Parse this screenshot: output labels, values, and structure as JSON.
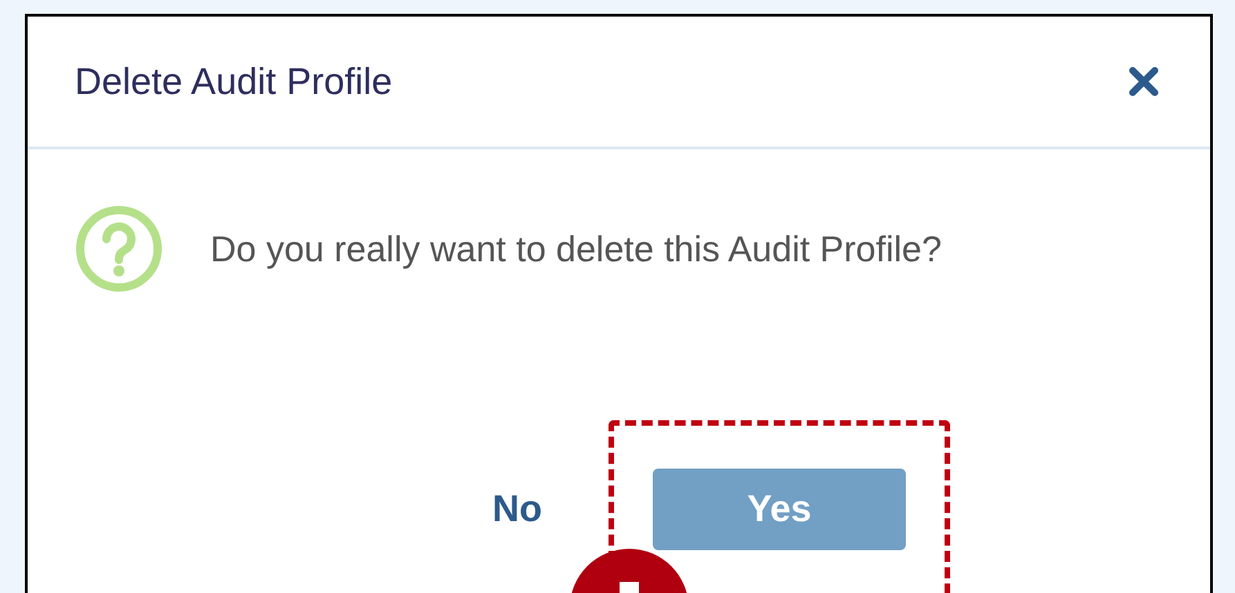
{
  "dialog": {
    "title": "Delete Audit Profile",
    "message": "Do you really want to delete this Audit Profile?",
    "buttons": [
      {
        "label": "No",
        "kind": "plain"
      },
      {
        "label": "Yes",
        "kind": "primary",
        "highlighted": true
      }
    ]
  }
}
